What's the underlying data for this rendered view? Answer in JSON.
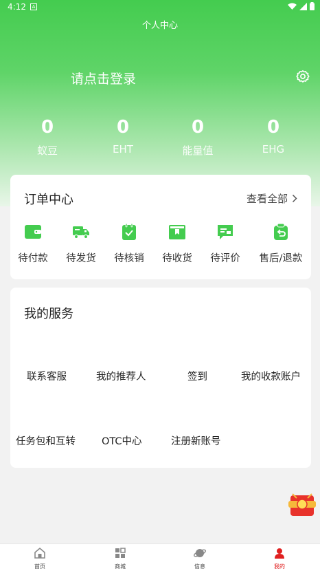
{
  "status": {
    "time": "4:12",
    "indicator": "A"
  },
  "header": {
    "title": "个人中心",
    "login_prompt": "请点击登录"
  },
  "stats": [
    {
      "value": "0",
      "label": "蚁豆"
    },
    {
      "value": "0",
      "label": "EHT"
    },
    {
      "value": "0",
      "label": "能量值"
    },
    {
      "value": "0",
      "label": "EHG"
    }
  ],
  "orders": {
    "title": "订单中心",
    "view_all": "查看全部",
    "items": [
      {
        "label": "待付款",
        "icon": "wallet-icon"
      },
      {
        "label": "待发货",
        "icon": "truck-icon"
      },
      {
        "label": "待核销",
        "icon": "clipboard-check-icon"
      },
      {
        "label": "待收货",
        "icon": "package-icon"
      },
      {
        "label": "待评价",
        "icon": "comment-icon"
      },
      {
        "label": "售后/退款",
        "icon": "refund-icon"
      }
    ]
  },
  "services": {
    "title": "我的服务",
    "items": [
      {
        "label": "联系客服"
      },
      {
        "label": "我的推荐人"
      },
      {
        "label": "签到"
      },
      {
        "label": "我的收款账户"
      },
      {
        "label": "任务包和互转"
      },
      {
        "label": "OTC中心"
      },
      {
        "label": "注册新账号"
      }
    ]
  },
  "tabs": [
    {
      "label": "首页",
      "icon": "home-icon"
    },
    {
      "label": "商城",
      "icon": "grid-icon"
    },
    {
      "label": "信息",
      "icon": "planet-icon"
    },
    {
      "label": "我的",
      "icon": "user-icon"
    }
  ],
  "colors": {
    "primary": "#44cc4f",
    "active_tab": "#e02020",
    "background": "#f2f2f2"
  }
}
